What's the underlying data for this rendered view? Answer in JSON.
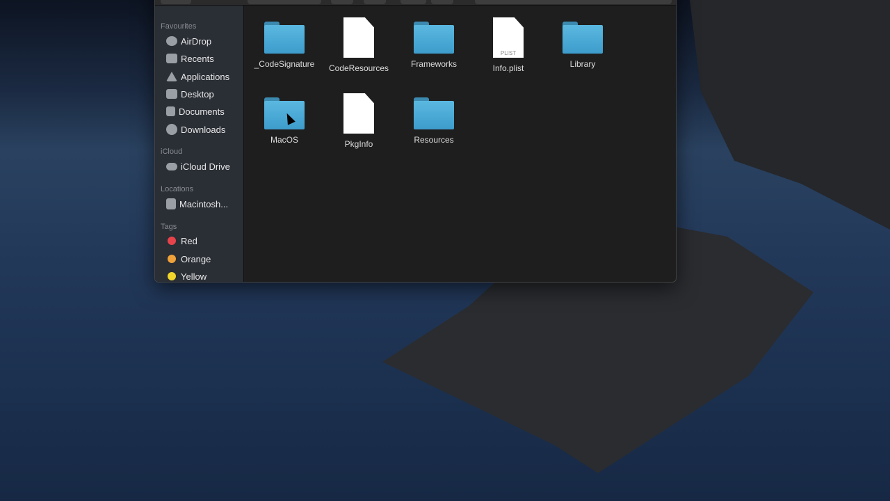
{
  "sidebar": {
    "favourites_header": "Favourites",
    "favourites": [
      {
        "label": "AirDrop",
        "icon": "airdrop-icon"
      },
      {
        "label": "Recents",
        "icon": "recents-icon"
      },
      {
        "label": "Applications",
        "icon": "applications-icon"
      },
      {
        "label": "Desktop",
        "icon": "desktop-icon"
      },
      {
        "label": "Documents",
        "icon": "documents-icon"
      },
      {
        "label": "Downloads",
        "icon": "downloads-icon"
      }
    ],
    "icloud_header": "iCloud",
    "icloud": [
      {
        "label": "iCloud Drive",
        "icon": "cloud-icon"
      }
    ],
    "locations_header": "Locations",
    "locations": [
      {
        "label": "Macintosh...",
        "icon": "hard-drive-icon"
      }
    ],
    "tags_header": "Tags",
    "tags": [
      {
        "label": "Red",
        "color": "#e8434b"
      },
      {
        "label": "Orange",
        "color": "#f0a23a"
      },
      {
        "label": "Yellow",
        "color": "#f2d52b"
      }
    ]
  },
  "files": [
    {
      "name": "_CodeSignature",
      "type": "folder"
    },
    {
      "name": "CodeResources",
      "type": "document"
    },
    {
      "name": "Frameworks",
      "type": "folder"
    },
    {
      "name": "Info.plist",
      "type": "plist",
      "badge": "PLIST"
    },
    {
      "name": "Library",
      "type": "folder"
    },
    {
      "name": "MacOS",
      "type": "folder"
    },
    {
      "name": "PkgInfo",
      "type": "document"
    },
    {
      "name": "Resources",
      "type": "folder"
    }
  ]
}
